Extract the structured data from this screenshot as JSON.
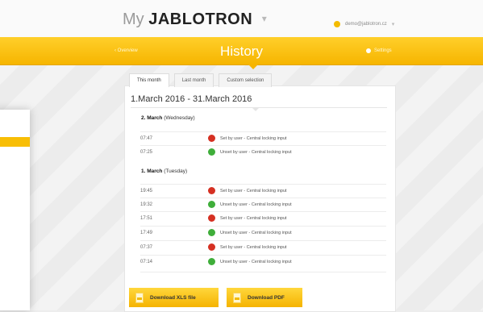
{
  "header": {
    "brand_prefix": "My",
    "brand_name": "JABLOTRON",
    "user_email": "demo@jablotron.cz"
  },
  "nav": {
    "overview": "‹ Overview",
    "title": "History",
    "settings": "Settings"
  },
  "tabs": [
    {
      "label": "This month",
      "active": true
    },
    {
      "label": "Last month",
      "active": false
    },
    {
      "label": "Custom selection",
      "active": false
    }
  ],
  "date_range": "1.March 2016 - 31.March 2016",
  "days": [
    {
      "day": "2. March",
      "weekday": "(Wednesday)",
      "events": [
        {
          "time": "07:47",
          "type": "set",
          "text": "Set by user - Central locking input"
        },
        {
          "time": "07:25",
          "type": "unset",
          "text": "Unset by user - Central locking input"
        }
      ]
    },
    {
      "day": "1. March",
      "weekday": "(Tuesday)",
      "events": [
        {
          "time": "19:45",
          "type": "set",
          "text": "Set by user - Central locking input"
        },
        {
          "time": "19:32",
          "type": "unset",
          "text": "Unset by user - Central locking input"
        },
        {
          "time": "17:51",
          "type": "set",
          "text": "Set by user - Central locking input"
        },
        {
          "time": "17:49",
          "type": "unset",
          "text": "Unset by user - Central locking input"
        },
        {
          "time": "07:37",
          "type": "set",
          "text": "Set by user - Central locking input"
        },
        {
          "time": "07:14",
          "type": "unset",
          "text": "Unset by user - Central locking input"
        }
      ]
    }
  ],
  "buttons": {
    "xls": "Download XLS file",
    "pdf": "Download PDF"
  },
  "colors": {
    "accent": "#f6b500",
    "set": "#d53022",
    "unset": "#3fae3a"
  }
}
